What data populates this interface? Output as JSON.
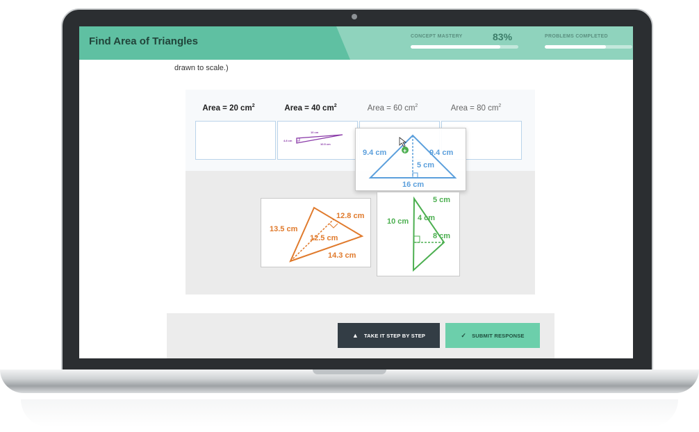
{
  "header": {
    "title": "Find Area of Triangles",
    "concept_mastery_label": "CONCEPT MASTERY",
    "concept_mastery_value": "83%",
    "concept_mastery_progress": 0.83,
    "problems_completed_label": "PROBLEMS COMPLETED",
    "problems_completed_progress": 0.7
  },
  "question": {
    "text_fragment": "drawn to scale.)"
  },
  "areas": [
    {
      "label": "Area = 20 cm",
      "exp": "2"
    },
    {
      "label": "Area = 40 cm",
      "exp": "2"
    },
    {
      "label": "Area = 60 cm",
      "exp": "2"
    },
    {
      "label": "Area = 80 cm",
      "exp": "2"
    }
  ],
  "triangles": {
    "purple": {
      "top": "10 cm",
      "left": "4.8 cm",
      "right": "10.5 cm"
    },
    "blue": {
      "left": "9.4 cm",
      "right": "9.4 cm",
      "height": "5 cm",
      "base": "16 cm"
    },
    "orange": {
      "a": "12.8 cm",
      "b": "13.5 cm",
      "c": "12.5 cm",
      "d": "14.3 cm"
    },
    "green": {
      "a": "5 cm",
      "b": "10 cm",
      "c": "4 cm",
      "d": "8 cm"
    }
  },
  "buttons": {
    "step_by_step": "TAKE IT STEP BY STEP",
    "submit": "SUBMIT RESPONSE"
  },
  "colors": {
    "header": "#8fd3bd",
    "header_dark": "#5fc0a2",
    "purple": "#8a3aa8",
    "blue": "#5b9fdc",
    "orange": "#e07a2c",
    "green": "#4caf50"
  }
}
